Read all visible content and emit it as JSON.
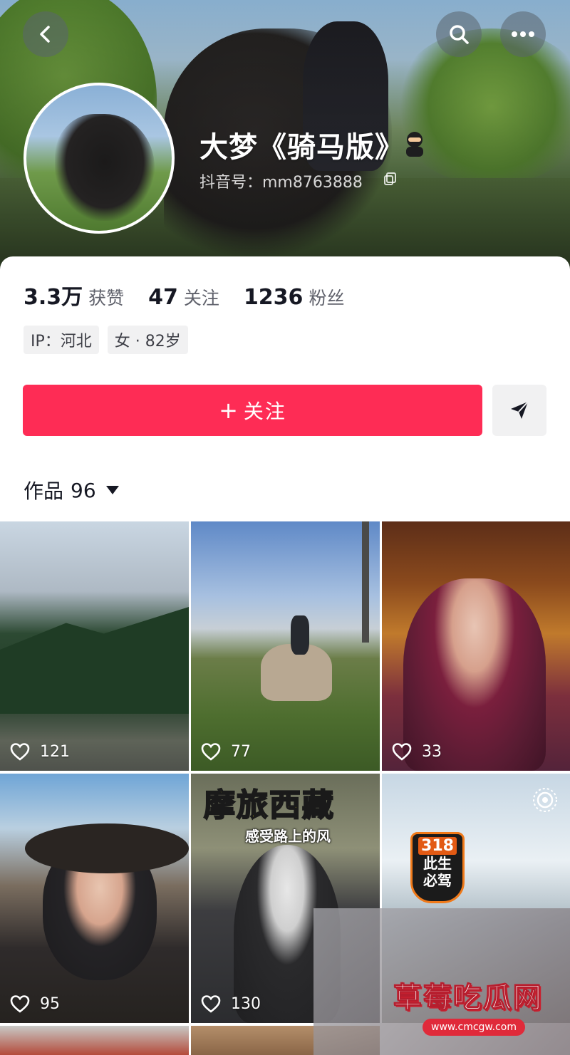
{
  "header": {
    "back_icon": "chevron-left-icon",
    "search_icon": "search-icon",
    "more_icon": "more-dots-icon"
  },
  "profile": {
    "name": "大梦《骑马版》",
    "handle": "抖音号：mm8763888",
    "badge_icon": "ninja-emoji-icon",
    "copy_icon": "copy-icon"
  },
  "stats": [
    {
      "value": "3.3万",
      "label": "获赞"
    },
    {
      "value": "47",
      "label": "关注"
    },
    {
      "value": "1236",
      "label": "粉丝"
    }
  ],
  "tags": [
    "IP：河北",
    "女 · 82岁"
  ],
  "actions": {
    "follow_label": "关注",
    "follow_prefix": "+",
    "send_icon": "send-message-icon",
    "accent_color": "#fe2c55"
  },
  "works_tab": {
    "label": "作品",
    "count": "96"
  },
  "videos": [
    {
      "likes": "121"
    },
    {
      "likes": "77"
    },
    {
      "likes": "33"
    },
    {
      "likes": "95"
    },
    {
      "likes": "130",
      "overlay_title": "摩旅西藏",
      "overlay_subtitle": "感受路上的风"
    },
    {
      "sign_number": "318",
      "sign_line1": "此生",
      "sign_line2": "必驾",
      "badge_icon": "live-photo-icon"
    }
  ],
  "watermark": {
    "title": "草莓吃瓜网",
    "url": "www.cmcgw.com"
  }
}
